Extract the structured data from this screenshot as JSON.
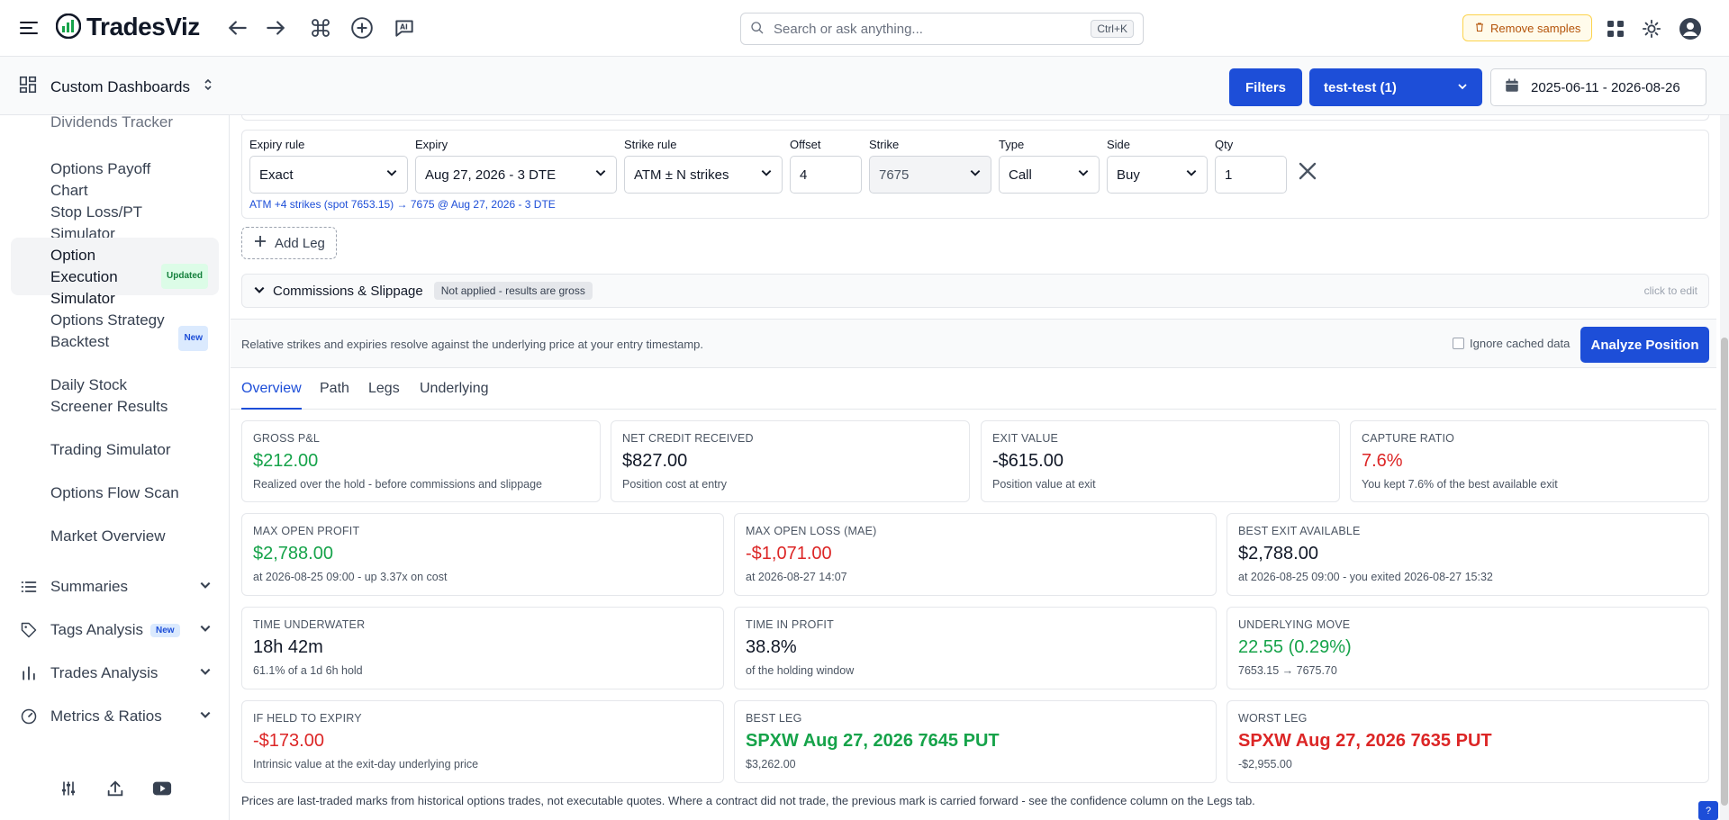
{
  "app": {
    "name": "TradesViz"
  },
  "topbar": {
    "search_placeholder": "Search or ask anything...",
    "search_shortcut": "Ctrl+K",
    "remove_samples_label": "Remove samples"
  },
  "subbar": {
    "dashboard_title": "Custom Dashboards",
    "filters_label": "Filters",
    "account_label": "test-test (1)",
    "date_range": "2025-06-11 - 2026-08-26"
  },
  "sidebar": {
    "items": [
      {
        "label": "Dividends Tracker"
      },
      {
        "label": "Options Payoff Chart"
      },
      {
        "label": "Stop Loss/PT Simulator"
      },
      {
        "label": "Option Execution Simulator",
        "badge": "Updated"
      },
      {
        "label": "Options Strategy Backtest",
        "badge": "New"
      },
      {
        "label": "Daily Stock Screener Results"
      },
      {
        "label": "Trading Simulator"
      },
      {
        "label": "Options Flow Scan"
      },
      {
        "label": "Market Overview"
      }
    ],
    "groups": [
      {
        "label": "Summaries"
      },
      {
        "label": "Tags Analysis",
        "badge": "New"
      },
      {
        "label": "Trades Analysis"
      },
      {
        "label": "Metrics & Ratios"
      }
    ]
  },
  "leg": {
    "labels": {
      "expiry_rule": "Expiry rule",
      "expiry": "Expiry",
      "strike_rule": "Strike rule",
      "offset": "Offset",
      "strike": "Strike",
      "type": "Type",
      "side": "Side",
      "qty": "Qty"
    },
    "values": {
      "expiry_rule": "Exact",
      "expiry": "Aug 27, 2026 - 3 DTE",
      "strike_rule": "ATM ± N strikes",
      "offset": "4",
      "strike": "7675",
      "type": "Call",
      "side": "Buy",
      "qty": "1"
    },
    "hint": "ATM +4 strikes (spot 7653.15) → 7675 @ Aug 27, 2026 - 3 DTE"
  },
  "add_leg_label": "Add Leg",
  "commissions": {
    "title": "Commissions & Slippage",
    "status": "Not applied - results are gross",
    "edit_hint": "click to edit"
  },
  "analyze": {
    "note": "Relative strikes and expiries resolve against the underlying price at your entry timestamp.",
    "ignore_cache_label": "Ignore cached data",
    "button_label": "Analyze Position"
  },
  "tabs": [
    {
      "label": "Overview"
    },
    {
      "label": "Path"
    },
    {
      "label": "Legs"
    },
    {
      "label": "Underlying"
    }
  ],
  "cards": {
    "gross_pnl": {
      "label": "GROSS P&L",
      "value": "$212.00",
      "sub": "Realized over the hold - before commissions and slippage"
    },
    "net_credit": {
      "label": "NET CREDIT RECEIVED",
      "value": "$827.00",
      "sub": "Position cost at entry"
    },
    "exit_value": {
      "label": "EXIT VALUE",
      "value": "-$615.00",
      "sub": "Position value at exit"
    },
    "capture_ratio": {
      "label": "CAPTURE RATIO",
      "value": "7.6%",
      "sub": "You kept 7.6% of the best available exit"
    },
    "max_open_profit": {
      "label": "MAX OPEN PROFIT",
      "value": "$2,788.00",
      "sub": "at 2026-08-25 09:00 - up 3.37x on cost"
    },
    "max_open_loss": {
      "label": "MAX OPEN LOSS (MAE)",
      "value": "-$1,071.00",
      "sub": "at 2026-08-27 14:07"
    },
    "best_exit": {
      "label": "BEST EXIT AVAILABLE",
      "value": "$2,788.00",
      "sub": "at 2026-08-25 09:00 - you exited 2026-08-27 15:32"
    },
    "time_underwater": {
      "label": "TIME UNDERWATER",
      "value": "18h 42m",
      "sub": "61.1% of a 1d 6h hold"
    },
    "time_in_profit": {
      "label": "TIME IN PROFIT",
      "value": "38.8%",
      "sub": "of the holding window"
    },
    "underlying_move": {
      "label": "UNDERLYING MOVE",
      "value": "22.55 (0.29%)",
      "sub": "7653.15 → 7675.70"
    },
    "held_to_expiry": {
      "label": "IF HELD TO EXPIRY",
      "value": "-$173.00",
      "sub": "Intrinsic value at the exit-day underlying price"
    },
    "best_leg": {
      "label": "BEST LEG",
      "value": "SPXW Aug 27, 2026 7645 PUT",
      "sub": "$3,262.00"
    },
    "worst_leg": {
      "label": "WORST LEG",
      "value": "SPXW Aug 27, 2026 7635 PUT",
      "sub": "-$2,955.00"
    }
  },
  "footer_note": "Prices are last-traded marks from historical options trades, not executable quotes. Where a contract did not trade, the previous mark is carried forward - see the confidence column on the Legs tab.",
  "colors": {
    "accent": "#1d4ed8",
    "positive": "#16a34a",
    "negative": "#dc2626"
  }
}
